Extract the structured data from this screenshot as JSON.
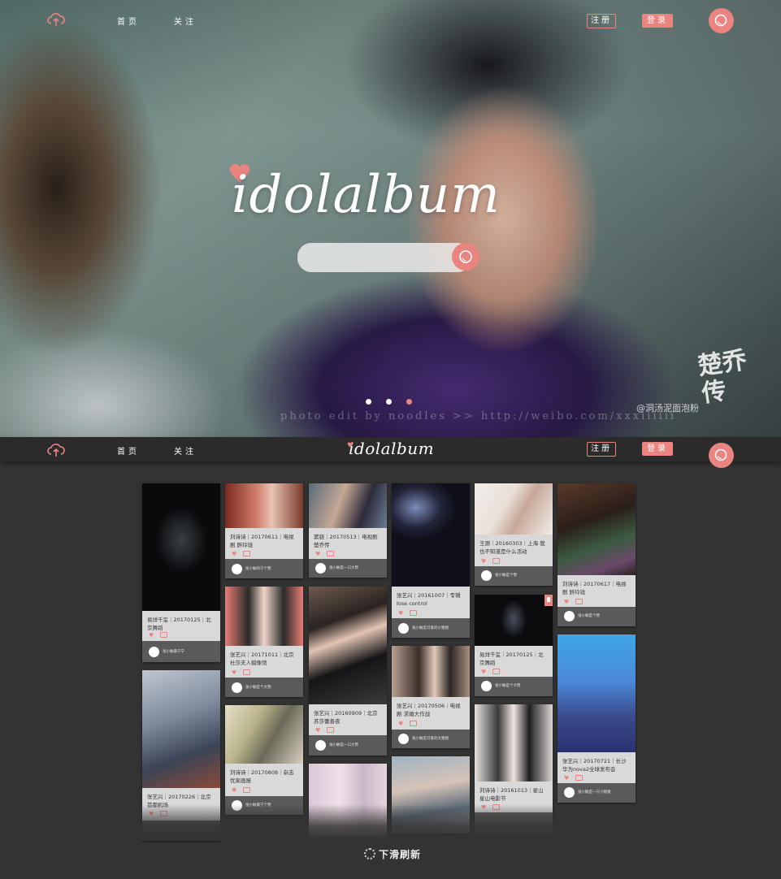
{
  "nav": {
    "home": "首页",
    "follow": "关注",
    "register": "注册",
    "login": "登录",
    "logo_icon": "cloud-upload-icon",
    "search_icon": "search-icon"
  },
  "hero": {
    "brand": "idolalbum",
    "search_placeholder": "",
    "watermark": "photo edit by noodles >> http://weibo.com/xxxiiiiii",
    "credit": "@洞汤泥面泡粉",
    "show_seal": "楚乔传",
    "carousel_active": 3,
    "carousel_count": 3
  },
  "sticky": {
    "brand": "idolalbum"
  },
  "colors": {
    "accent": "#e98480",
    "bg": "#333333",
    "card_info": "#d9d9d9",
    "card_user": "#5a5a5a"
  },
  "cards": [
    {
      "title": "易烊千玺｜20170125｜北京舞蹈",
      "user": "张小敏最宁宁"
    },
    {
      "title": "张艺兴｜20170226｜北京首都机场",
      "user": ""
    },
    {
      "title": "刘诗诗｜20170611｜电视剧 醉玲珑",
      "user": "张小敏的宁个赞"
    },
    {
      "title": "张艺兴｜20171011｜北京杜莎夫人蜡像馆",
      "user": "张小敏是个大赞"
    },
    {
      "title": "刘诗诗｜20170808｜杂志优家画报",
      "user": "张小敏最宁个赞"
    },
    {
      "title": "窦骁｜20170513｜电视剧 楚乔传",
      "user": "张小敏是一口大赞"
    },
    {
      "title": "张艺兴｜20160909｜北京 苏莎蕾善夜",
      "user": "张小敏是一口大赞"
    },
    {
      "title": "张艺兴｜20161007｜专辑 lose control",
      "user": "张小敏是可爱的小猪猪"
    },
    {
      "title": "张艺兴｜20170506｜电视剧 求婚大作战",
      "user": "张小敏是可爱的大猪猪"
    },
    {
      "title": "王源｜20160303｜上海 我也不知道是什么活动",
      "user": "张小敏是个赞"
    },
    {
      "title": "易烊千玺｜20170125｜北京舞蹈",
      "user": "张小敏是个大赞"
    },
    {
      "title": "刘诗诗｜20161013｜星山 星山电影节",
      "user": ""
    },
    {
      "title": "刘诗诗｜20170617｜电视剧 醉玲珑",
      "user": "张小敏是个赞"
    },
    {
      "title": "张艺兴｜20170721｜长沙 华为nova2全球发布会",
      "user": "张小敏是一只小猪猪"
    }
  ],
  "refresh_text": "下滑刷新"
}
